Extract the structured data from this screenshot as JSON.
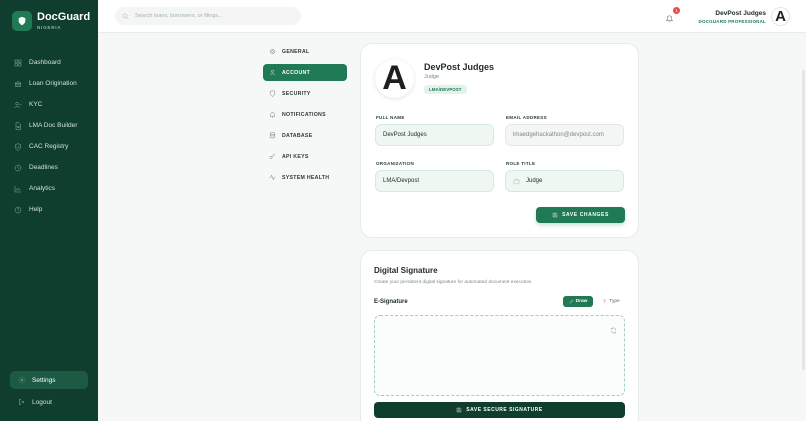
{
  "brand": {
    "title": "DocGuard",
    "subtitle": "NIGERIA",
    "logo_icon": "shield-icon"
  },
  "sidebar": {
    "items": [
      {
        "label": "Dashboard",
        "icon": "grid-icon"
      },
      {
        "label": "Loan Origination",
        "icon": "bank-icon"
      },
      {
        "label": "KYC",
        "icon": "user-check-icon"
      },
      {
        "label": "LMA Doc Builder",
        "icon": "document-icon"
      },
      {
        "label": "CAC Registry",
        "icon": "shield-check-icon"
      },
      {
        "label": "Deadlines",
        "icon": "clock-icon"
      },
      {
        "label": "Analytics",
        "icon": "chart-icon"
      },
      {
        "label": "Help",
        "icon": "help-icon"
      }
    ],
    "settings_label": "Settings",
    "logout_label": "Logout"
  },
  "topbar": {
    "search_placeholder": "Search loans, borrowers, or filings...",
    "notification_count": "1",
    "user_name": "DevPost Judges",
    "user_role": "DOCGUARD PROFESSIONAL",
    "avatar_letter": "A"
  },
  "settings_menu": [
    {
      "label": "GENERAL",
      "icon": "gear-icon",
      "active": false
    },
    {
      "label": "ACCOUNT",
      "icon": "user-icon",
      "active": true
    },
    {
      "label": "SECURITY",
      "icon": "shield-icon",
      "active": false
    },
    {
      "label": "NOTIFICATIONS",
      "icon": "bell-icon",
      "active": false
    },
    {
      "label": "DATABASE",
      "icon": "database-icon",
      "active": false
    },
    {
      "label": "API KEYS",
      "icon": "key-icon",
      "active": false
    },
    {
      "label": "SYSTEM HEALTH",
      "icon": "activity-icon",
      "active": false
    }
  ],
  "profile": {
    "avatar_letter": "A",
    "name": "DevPost Judges",
    "title": "Judge",
    "org_badge": "LMA/DEVPOST",
    "fields": {
      "full_name_label": "FULL NAME",
      "full_name_value": "DevPost Judges",
      "email_label": "EMAIL ADDRESS",
      "email_value": "lmaedgehackathon@devpost.com",
      "organization_label": "ORGANIZATION",
      "organization_value": "LMA/Devpost",
      "role_label": "ROLE TITLE",
      "role_value": "Judge"
    },
    "save_label": "SAVE CHANGES"
  },
  "signature": {
    "title": "Digital Signature",
    "description": "Create your persistent digital signature for automated document execution.",
    "label": "E-Signature",
    "draw_label": "Draw",
    "type_label": "Type",
    "save_label": "SAVE SECURE SIGNATURE"
  },
  "colors": {
    "primary": "#1f7a55",
    "sidebar": "#0f3d2e",
    "accent_bg": "#eef7f2",
    "badge": "#e24d4d"
  }
}
